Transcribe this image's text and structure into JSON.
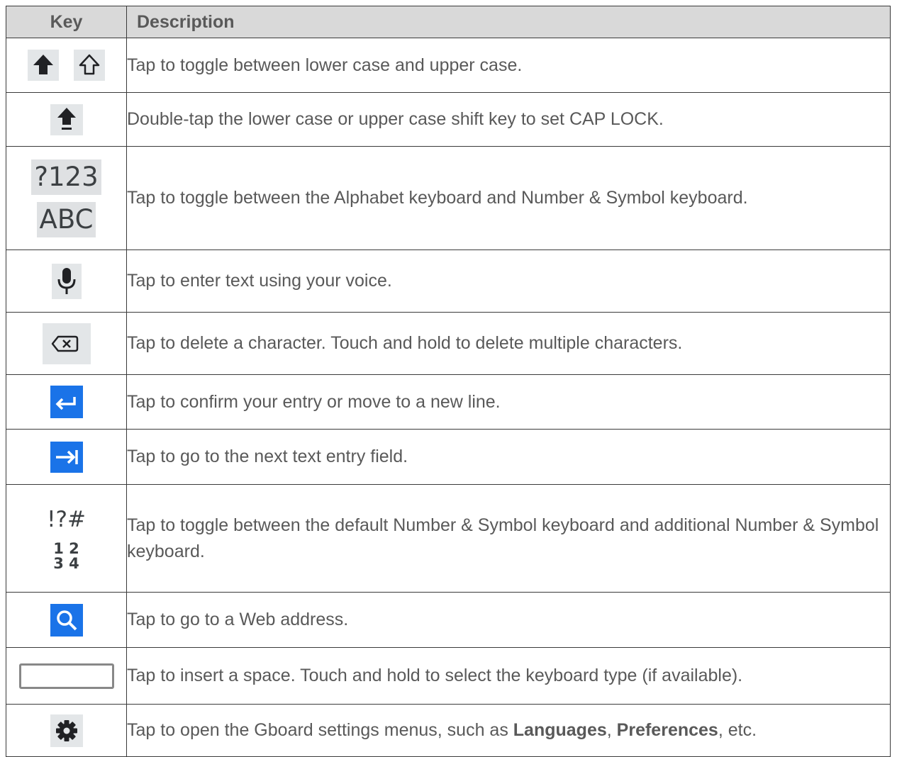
{
  "header": {
    "key": "Key",
    "description": "Description"
  },
  "rows": [
    {
      "icon": "shift-icon",
      "description": "Tap to toggle between lower case and upper case."
    },
    {
      "icon": "caps-lock-icon",
      "description": "Double-tap the lower case or upper case shift key to set CAP LOCK."
    },
    {
      "icon": "symbol-alphabet-toggle",
      "key_top": "?123",
      "key_bottom": "ABC",
      "description": "Tap to toggle between the Alphabet keyboard and Number & Symbol keyboard."
    },
    {
      "icon": "microphone-icon",
      "description": "Tap to enter text using your voice."
    },
    {
      "icon": "backspace-icon",
      "description": "Tap to delete a character. Touch and hold to delete multiple characters."
    },
    {
      "icon": "enter-icon",
      "description": "Tap to confirm your entry or move to a new line."
    },
    {
      "icon": "next-field-icon",
      "description": "Tap to go to the next text entry field."
    },
    {
      "icon": "more-symbols-toggle",
      "key_top": "!?#",
      "key_bottom_1": "1 2",
      "key_bottom_2": "3 4",
      "description": "Tap to toggle between the default Number & Symbol keyboard and additional Number & Symbol keyboard."
    },
    {
      "icon": "search-icon",
      "description": "Tap to go to a Web address."
    },
    {
      "icon": "space-bar-icon",
      "description": "Tap to insert a space. Touch and hold to select the keyboard type (if available)."
    },
    {
      "icon": "gear-icon",
      "description_prefix": "Tap to open the Gboard settings menus, such as ",
      "description_bold_1": "Languages",
      "description_sep": ", ",
      "description_bold_2": "Preferences",
      "description_suffix": ", etc."
    }
  ],
  "colors": {
    "header_bg": "#d9d9d9",
    "key_gray": "#e3e6e8",
    "key_blue": "#1a73e8",
    "text": "#595959"
  }
}
